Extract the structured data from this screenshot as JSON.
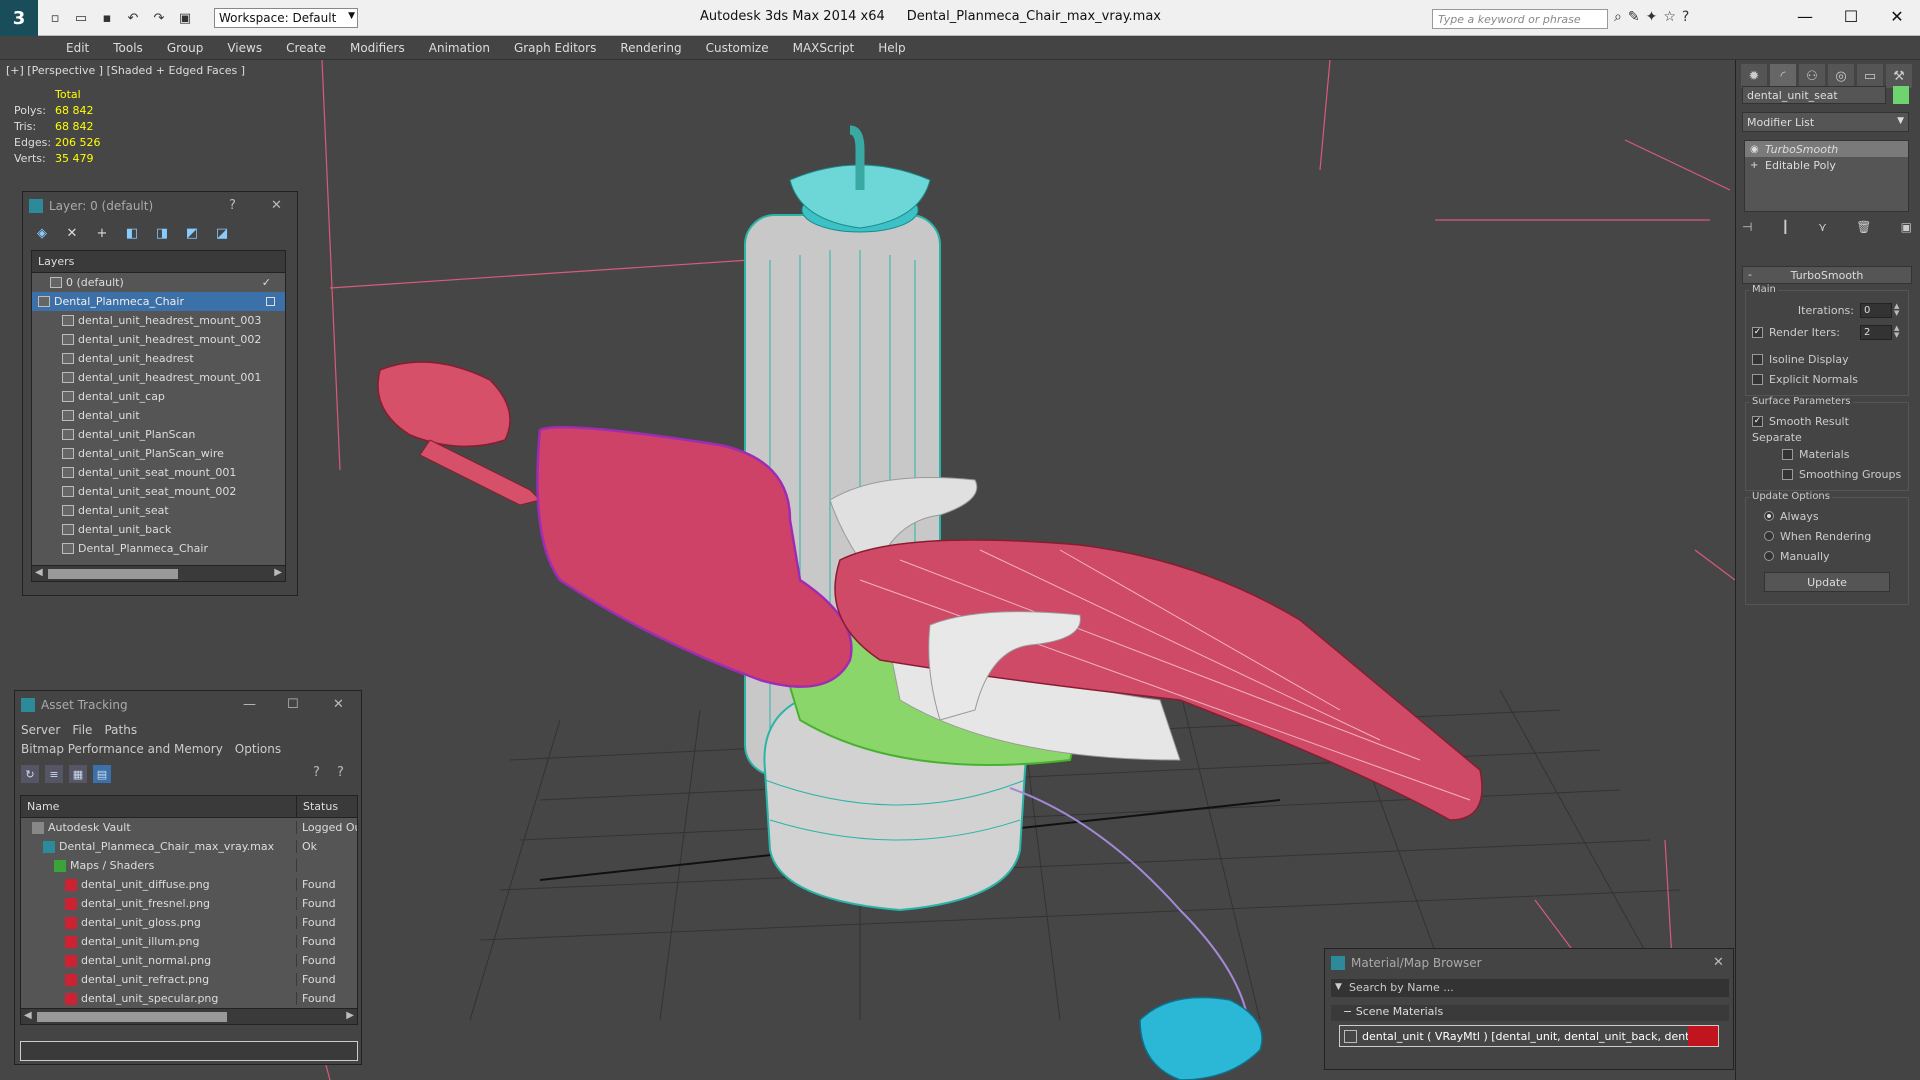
{
  "titlebar": {
    "workspace": "Workspace: Default",
    "app": "Autodesk 3ds Max  2014 x64",
    "file": "Dental_Planmeca_Chair_max_vray.max",
    "search_placeholder": "Type a keyword or phrase"
  },
  "menu": [
    "Edit",
    "Tools",
    "Group",
    "Views",
    "Create",
    "Modifiers",
    "Animation",
    "Graph Editors",
    "Rendering",
    "Customize",
    "MAXScript",
    "Help"
  ],
  "viewport": {
    "label": "[+] [Perspective ] [Shaded + Edged Faces ]",
    "stats": {
      "header": "Total",
      "rows": [
        {
          "k": "Polys:",
          "v": "68 842"
        },
        {
          "k": "Tris:",
          "v": "68 842"
        },
        {
          "k": "Edges:",
          "v": "206 526"
        },
        {
          "k": "Verts:",
          "v": "35 479"
        }
      ]
    }
  },
  "layer_panel": {
    "title": "Layer: 0 (default)",
    "help": "?",
    "header": "Layers",
    "rows": [
      {
        "label": "0 (default)",
        "indent": 1,
        "check": "✓"
      },
      {
        "label": "Dental_Planmeca_Chair",
        "indent": 0,
        "selected": true
      },
      {
        "label": "dental_unit_headrest_mount_003",
        "indent": 2
      },
      {
        "label": "dental_unit_headrest_mount_002",
        "indent": 2
      },
      {
        "label": "dental_unit_headrest",
        "indent": 2
      },
      {
        "label": "dental_unit_headrest_mount_001",
        "indent": 2
      },
      {
        "label": "dental_unit_cap",
        "indent": 2
      },
      {
        "label": "dental_unit",
        "indent": 2
      },
      {
        "label": "dental_unit_PlanScan",
        "indent": 2
      },
      {
        "label": "dental_unit_PlanScan_wire",
        "indent": 2
      },
      {
        "label": "dental_unit_seat_mount_001",
        "indent": 2
      },
      {
        "label": "dental_unit_seat_mount_002",
        "indent": 2
      },
      {
        "label": "dental_unit_seat",
        "indent": 2
      },
      {
        "label": "dental_unit_back",
        "indent": 2
      },
      {
        "label": "Dental_Planmeca_Chair",
        "indent": 2
      }
    ]
  },
  "asset_panel": {
    "title": "Asset Tracking",
    "menu": [
      "Server",
      "File",
      "Paths",
      "Bitmap Performance and Memory",
      "Options"
    ],
    "col_name": "Name",
    "col_status": "Status",
    "rows": [
      {
        "name": "Autodesk Vault",
        "status": "Logged Ou",
        "indent": 1,
        "icon": "vault"
      },
      {
        "name": "Dental_Planmeca_Chair_max_vray.max",
        "status": "Ok",
        "indent": 2,
        "icon": "max"
      },
      {
        "name": "Maps / Shaders",
        "status": "",
        "indent": 3,
        "icon": "maps"
      },
      {
        "name": "dental_unit_diffuse.png",
        "status": "Found",
        "indent": 4,
        "icon": "png"
      },
      {
        "name": "dental_unit_fresnel.png",
        "status": "Found",
        "indent": 4,
        "icon": "png"
      },
      {
        "name": "dental_unit_gloss.png",
        "status": "Found",
        "indent": 4,
        "icon": "png"
      },
      {
        "name": "dental_unit_illum.png",
        "status": "Found",
        "indent": 4,
        "icon": "png"
      },
      {
        "name": "dental_unit_normal.png",
        "status": "Found",
        "indent": 4,
        "icon": "png"
      },
      {
        "name": "dental_unit_refract.png",
        "status": "Found",
        "indent": 4,
        "icon": "png"
      },
      {
        "name": "dental_unit_specular.png",
        "status": "Found",
        "indent": 4,
        "icon": "png"
      }
    ]
  },
  "material_browser": {
    "title": "Material/Map Browser",
    "search_placeholder": "Search by Name ...",
    "section": "Scene Materials",
    "item": "dental_unit  ( VRayMtl ) [dental_unit, dental_unit_back, dental_unit_cap, dental_unit_headrest, denta..."
  },
  "command_panel": {
    "object_name": "dental_unit_seat",
    "object_color": "#6fd36f",
    "modifier_list": "Modifier List",
    "stack": [
      {
        "label": "TurboSmooth",
        "selected": true
      },
      {
        "label": "Editable Poly",
        "selected": false
      }
    ],
    "turbosmooth": {
      "title": "TurboSmooth",
      "main": "Main",
      "iterations_label": "Iterations:",
      "iterations": "0",
      "render_iters_label": "Render Iters:",
      "render_iters": "2",
      "isoline": "Isoline Display",
      "explicit_normals": "Explicit Normals",
      "surface_params": "Surface Parameters",
      "smooth_result": "Smooth Result",
      "separate": "Separate",
      "materials": "Materials",
      "smoothing_groups": "Smoothing Groups",
      "update_options": "Update Options",
      "always": "Always",
      "when_rendering": "When Rendering",
      "manually": "Manually",
      "update_btn": "Update"
    }
  }
}
